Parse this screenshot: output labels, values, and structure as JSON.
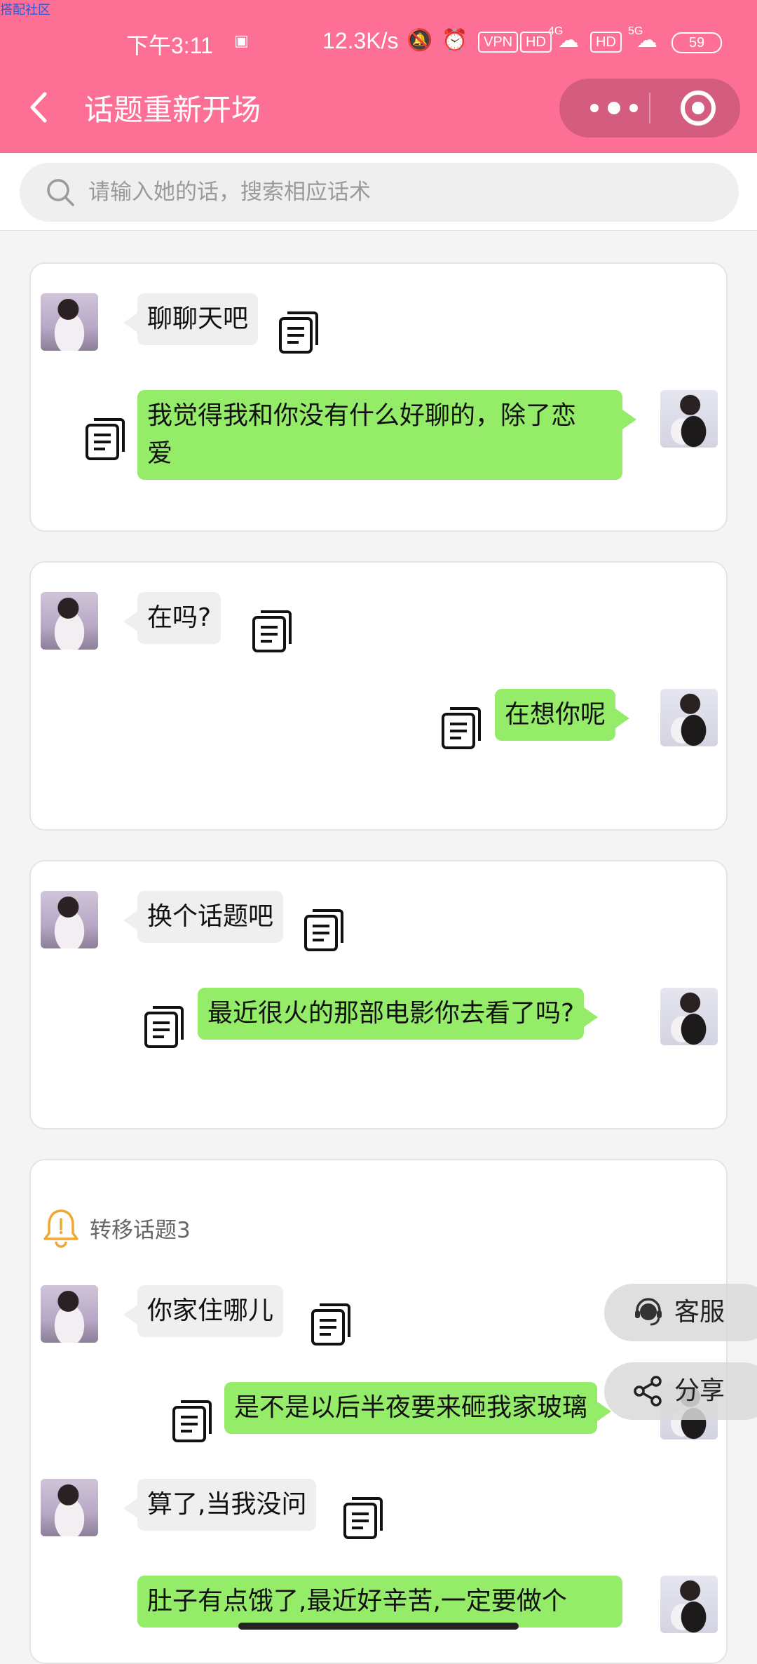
{
  "watermark": "搭配社区",
  "status_bar": {
    "time": "下午3:11",
    "speed": "12.3K/s",
    "vpn": "VPN",
    "hd": "HD",
    "net1": "4G",
    "net2": "5G",
    "battery": "59"
  },
  "header": {
    "title": "话题重新开场",
    "bg_color": "#fe6f95"
  },
  "search": {
    "placeholder": "请输入她的话，搜索相应话术"
  },
  "cards": [
    {
      "her": "聊聊天吧",
      "me": [
        "我觉得我和你没有什么好聊的，除了恋",
        "爱"
      ]
    },
    {
      "her": "在吗?",
      "me": [
        "在想你呢"
      ]
    },
    {
      "her": "换个话题吧",
      "me": [
        "最近很火的那部电影你去看了吗?"
      ]
    },
    {
      "topic": "转移话题3",
      "pairs": [
        {
          "her": "你家住哪儿",
          "me": "是不是以后半夜要来砸我家玻璃"
        },
        {
          "her": "算了,当我没问",
          "me": "肚子有点饿了,最近好辛苦,一定要做个"
        }
      ]
    }
  ],
  "floating": {
    "service": "客服",
    "share": "分享"
  },
  "colors": {
    "my_bubble": "#95ec69",
    "her_bubble": "#efefef",
    "bell": "#f0a830"
  }
}
